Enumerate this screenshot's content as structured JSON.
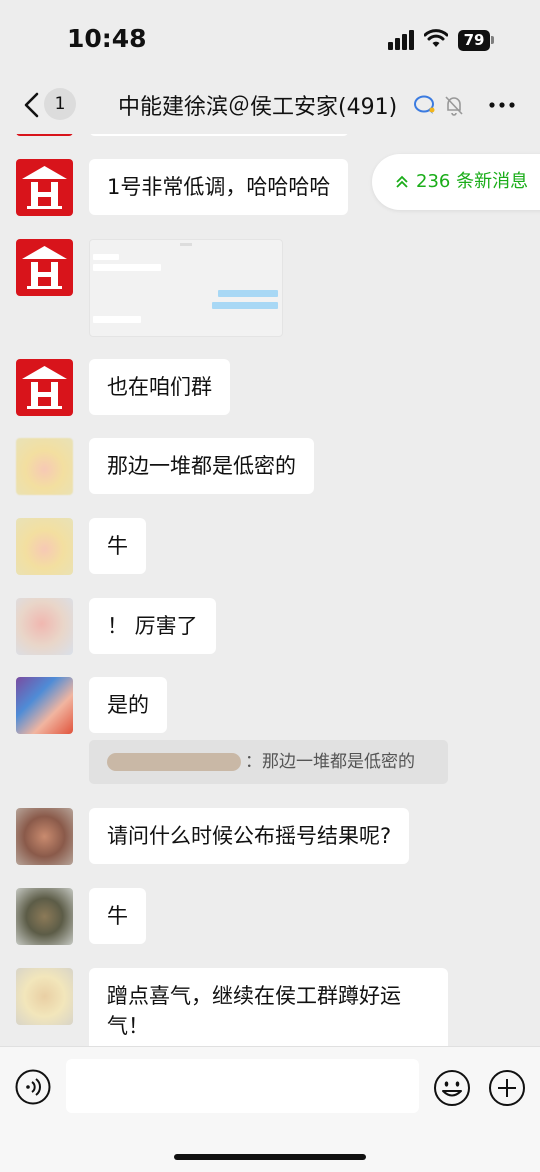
{
  "status": {
    "time": "10:48",
    "battery": "79"
  },
  "nav": {
    "unread_count": "1",
    "title": "中能建徐滨＠侯工安家(491)"
  },
  "new_messages": "236 条新消息",
  "messages": {
    "m1": "1号非常低调，哈哈哈哈",
    "m3": "也在咱们群",
    "m4": "那边一堆都是低密的",
    "m5": "牛",
    "m6": "！ 厉害了",
    "m7": "是的",
    "m7_quote": "：那边一堆都是低密的",
    "m8": "请问什么时候公布摇号结果呢?",
    "m9": "牛",
    "m10_line1": "蹭点喜气，继续在侯工群蹲好运",
    "m10_line2": "气！"
  },
  "icons": {
    "back": "chevron-left-icon",
    "voice": "voice-icon",
    "emoji": "emoji-icon",
    "plus": "plus-icon",
    "mute": "bell-off-icon",
    "more": "more-icon",
    "new_msg_arrow": "double-chevron-up-icon"
  },
  "colors": {
    "accent": "#1aad19",
    "avatar_red": "#d8141b",
    "background": "#ededed"
  }
}
